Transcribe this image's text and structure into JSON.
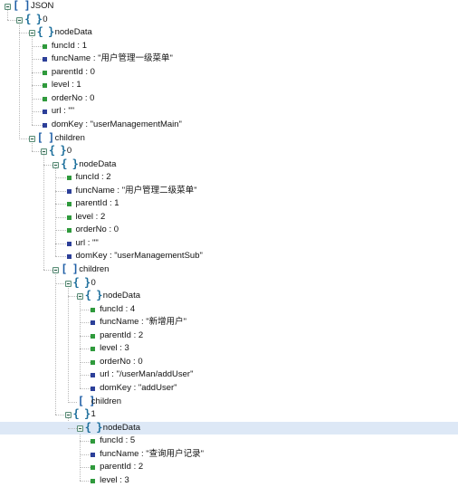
{
  "tree": {
    "rows": [
      {
        "depth": 0,
        "kind": "array",
        "text": "JSON",
        "selected": false
      },
      {
        "depth": 1,
        "kind": "object",
        "text": "0",
        "selected": false
      },
      {
        "depth": 2,
        "kind": "object",
        "text": "nodeData",
        "selected": false
      },
      {
        "depth": 3,
        "kind": "number",
        "text": "funcId : 1",
        "selected": false
      },
      {
        "depth": 3,
        "kind": "string",
        "text": "funcName : \"用户管理一级菜单\"",
        "selected": false
      },
      {
        "depth": 3,
        "kind": "number",
        "text": "parentId : 0",
        "selected": false
      },
      {
        "depth": 3,
        "kind": "number",
        "text": "level : 1",
        "selected": false
      },
      {
        "depth": 3,
        "kind": "number",
        "text": "orderNo : 0",
        "selected": false
      },
      {
        "depth": 3,
        "kind": "string",
        "text": "url : \"\"",
        "selected": false
      },
      {
        "depth": 3,
        "kind": "string",
        "text": "domKey : \"userManagementMain\"",
        "selected": false
      },
      {
        "depth": 2,
        "kind": "array",
        "text": "children",
        "selected": false
      },
      {
        "depth": 3,
        "kind": "object",
        "text": "0",
        "selected": false
      },
      {
        "depth": 4,
        "kind": "object",
        "text": "nodeData",
        "selected": false
      },
      {
        "depth": 5,
        "kind": "number",
        "text": "funcId : 2",
        "selected": false
      },
      {
        "depth": 5,
        "kind": "string",
        "text": "funcName : \"用户管理二级菜单\"",
        "selected": false
      },
      {
        "depth": 5,
        "kind": "number",
        "text": "parentId : 1",
        "selected": false
      },
      {
        "depth": 5,
        "kind": "number",
        "text": "level : 2",
        "selected": false
      },
      {
        "depth": 5,
        "kind": "number",
        "text": "orderNo : 0",
        "selected": false
      },
      {
        "depth": 5,
        "kind": "string",
        "text": "url : \"\"",
        "selected": false
      },
      {
        "depth": 5,
        "kind": "string",
        "text": "domKey : \"userManagementSub\"",
        "selected": false
      },
      {
        "depth": 4,
        "kind": "array",
        "text": "children",
        "selected": false
      },
      {
        "depth": 5,
        "kind": "object",
        "text": "0",
        "selected": false
      },
      {
        "depth": 6,
        "kind": "object",
        "text": "nodeData",
        "selected": false
      },
      {
        "depth": 7,
        "kind": "number",
        "text": "funcId : 4",
        "selected": false
      },
      {
        "depth": 7,
        "kind": "string",
        "text": "funcName : \"新增用户\"",
        "selected": false
      },
      {
        "depth": 7,
        "kind": "number",
        "text": "parentId : 2",
        "selected": false
      },
      {
        "depth": 7,
        "kind": "number",
        "text": "level : 3",
        "selected": false
      },
      {
        "depth": 7,
        "kind": "number",
        "text": "orderNo : 0",
        "selected": false
      },
      {
        "depth": 7,
        "kind": "string",
        "text": "url : \"/userMan/addUser\"",
        "selected": false
      },
      {
        "depth": 7,
        "kind": "string",
        "text": "domKey : \"addUser\"",
        "selected": false
      },
      {
        "depth": 6,
        "kind": "array-empty",
        "text": "children",
        "selected": false
      },
      {
        "depth": 5,
        "kind": "object",
        "text": "1",
        "selected": false
      },
      {
        "depth": 6,
        "kind": "object",
        "text": "nodeData",
        "selected": true
      },
      {
        "depth": 7,
        "kind": "number",
        "text": "funcId : 5",
        "selected": false
      },
      {
        "depth": 7,
        "kind": "string",
        "text": "funcName : \"查询用户记录\"",
        "selected": false
      },
      {
        "depth": 7,
        "kind": "number",
        "text": "parentId : 2",
        "selected": false
      },
      {
        "depth": 7,
        "kind": "number",
        "text": "level : 3",
        "selected": false
      }
    ]
  },
  "icons": {
    "array": "array-bracket-icon",
    "object": "object-brace-icon",
    "number": "number-leaf-icon",
    "string": "string-leaf-icon",
    "toggle": "collapse-toggle-icon"
  },
  "colors": {
    "selection": "#dde8f6",
    "number_leaf": "#2f9a3c",
    "string_leaf": "#2c3f99",
    "container_icon": "#1d5f9c"
  }
}
